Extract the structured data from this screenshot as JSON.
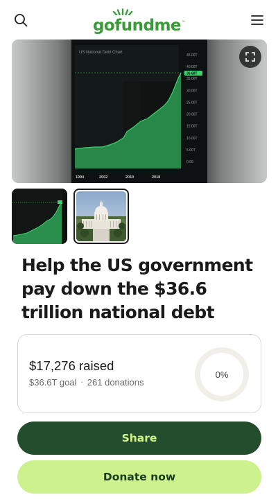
{
  "header": {
    "logo_text": "gofundme",
    "logo_tm": "™",
    "search_icon": "search-icon",
    "menu_icon": "hamburger-menu-icon"
  },
  "gallery": {
    "hero_chart_title": "US National Debt Chart",
    "hero_chart_years": [
      "1994",
      "2002",
      "2010",
      "2018"
    ],
    "hero_chart_yticks": [
      "45.00T",
      "40.00T",
      "35.00T",
      "30.00T",
      "25.00T",
      "20.00T",
      "15.00T",
      "10.00T",
      "5.00T",
      "0.00"
    ],
    "hero_chart_marker": "36.68T",
    "expand_icon": "expand-icon",
    "thumbnails": [
      "debt-chart-thumbnail",
      "capitol-building-thumbnail"
    ]
  },
  "campaign": {
    "title": "Help the US government pay down the $36.6 trillion national debt"
  },
  "progress": {
    "raised": "$17,276 raised",
    "goal": "$36.6T goal",
    "separator": "·",
    "donations": "261 donations",
    "percent": "0%",
    "percent_value": 0
  },
  "actions": {
    "share_label": "Share",
    "donate_label": "Donate now"
  },
  "colors": {
    "brand_green": "#3a9a3a",
    "share_bg": "#234d2c",
    "share_text": "#d1f58a",
    "donate_bg": "#cdf28d",
    "donate_text": "#1e3d1f",
    "chart_green": "#2fae57"
  }
}
